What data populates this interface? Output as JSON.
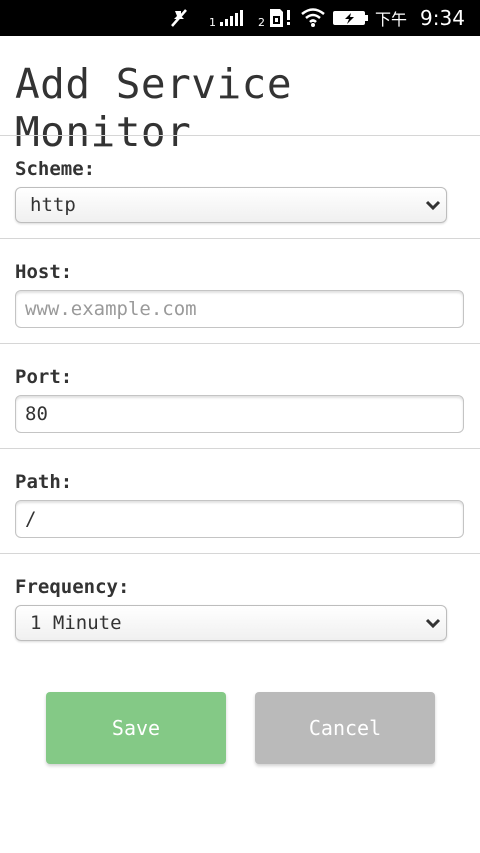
{
  "status_bar": {
    "sim1_label": "1",
    "sim2_label": "2",
    "ampm": "下午",
    "time": "9:34",
    "icons": [
      "no-notification-icon",
      "signal-icon",
      "sim-warning-icon",
      "wifi-icon",
      "battery-charging-icon"
    ]
  },
  "page": {
    "title": "Add Service Monitor"
  },
  "form": {
    "scheme": {
      "label": "Scheme:",
      "value": "http"
    },
    "host": {
      "label": "Host:",
      "value": "",
      "placeholder": "www.example.com"
    },
    "port": {
      "label": "Port:",
      "value": "80"
    },
    "path": {
      "label": "Path:",
      "value": "/"
    },
    "frequency": {
      "label": "Frequency:",
      "value": "1 Minute"
    }
  },
  "actions": {
    "save_label": "Save",
    "cancel_label": "Cancel",
    "save_color": "#84c986",
    "cancel_color": "#bababa"
  }
}
